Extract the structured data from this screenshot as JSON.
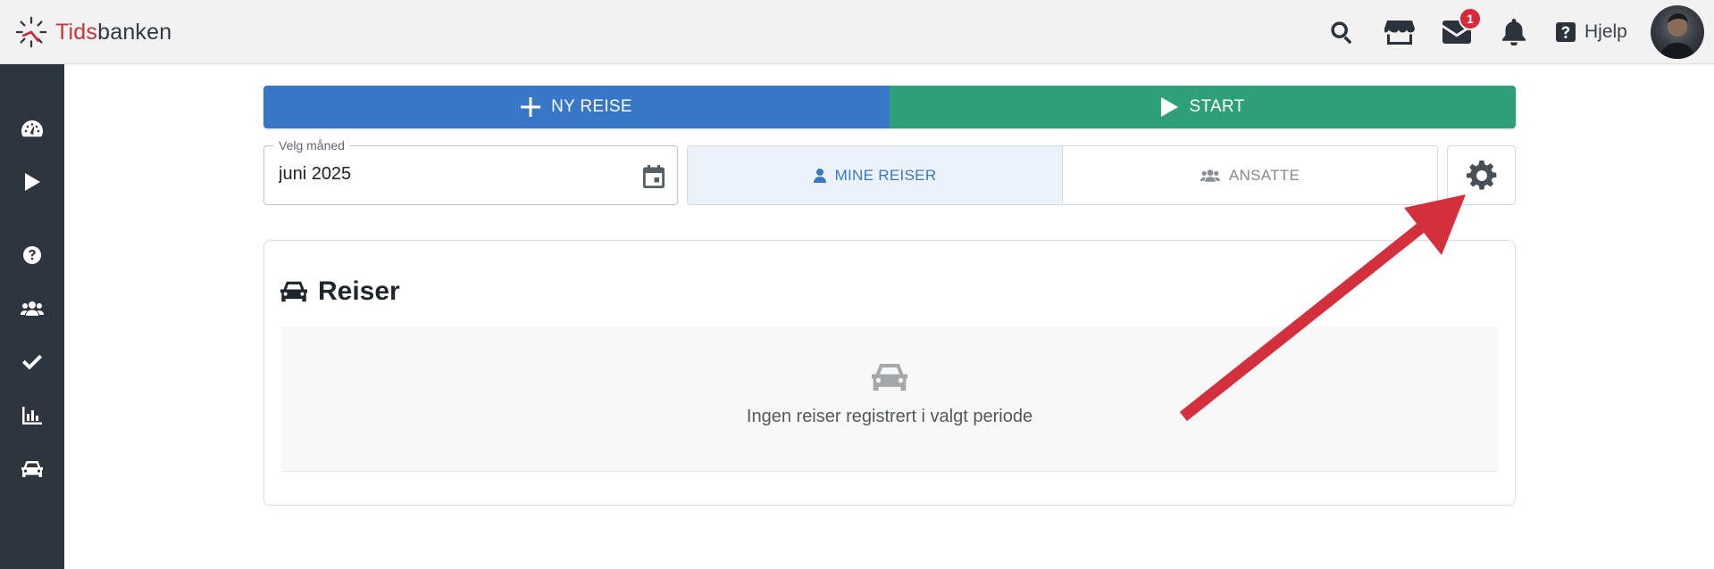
{
  "header": {
    "logo": {
      "part1": "Tids",
      "part2": "banken"
    },
    "icons": [
      {
        "name": "search-icon"
      },
      {
        "name": "store-icon"
      },
      {
        "name": "mail-icon",
        "badge": "1"
      },
      {
        "name": "bell-icon"
      }
    ],
    "help_label": "Hjelp"
  },
  "sidebar": {
    "items": [
      {
        "icon": "dashboard-icon"
      },
      {
        "icon": "play-icon"
      },
      {
        "icon": "help-circle-icon"
      },
      {
        "icon": "users-icon"
      },
      {
        "icon": "check-icon"
      },
      {
        "icon": "chart-icon"
      },
      {
        "icon": "car-icon"
      }
    ]
  },
  "actions": {
    "new_label": "NY REISE",
    "start_label": "START"
  },
  "month_picker": {
    "label": "Velg måned",
    "value": "juni 2025"
  },
  "tabs": {
    "mine_label": "MINE REISER",
    "ansatte_label": "ANSATTE"
  },
  "card": {
    "title": "Reiser",
    "empty_text": "Ingen reiser registrert i valgt periode"
  },
  "colors": {
    "primary_blue": "#3877c8",
    "start_green": "#2f9f78",
    "sidebar_bg": "#2d353f",
    "badge_red": "#d7293a",
    "arrow_red": "#d32f3c"
  }
}
